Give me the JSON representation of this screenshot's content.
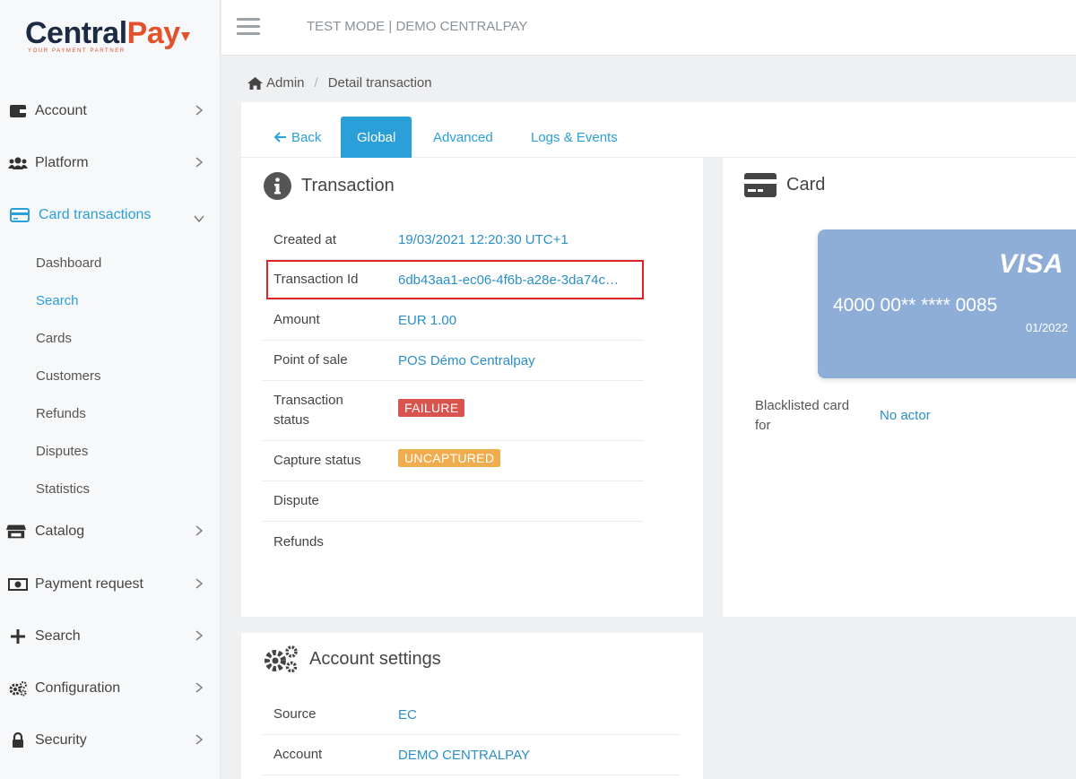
{
  "app": {
    "logo_main_dark": "Central",
    "logo_main_accent": "Pay",
    "logo_tagline": "YOUR PAYMENT PARTNER",
    "mode_label": "TEST MODE | DEMO CENTRALPAY"
  },
  "sidebar": {
    "items": [
      {
        "label": "Account",
        "icon": "wallet-icon"
      },
      {
        "label": "Platform",
        "icon": "users-icon"
      },
      {
        "label": "Card transactions",
        "icon": "credit-card-icon"
      },
      {
        "label": "Catalog",
        "icon": "store-icon"
      },
      {
        "label": "Payment request",
        "icon": "money-bill-icon"
      },
      {
        "label": "Search",
        "icon": "plus-icon"
      },
      {
        "label": "Configuration",
        "icon": "cogs-icon"
      },
      {
        "label": "Security",
        "icon": "lock-icon"
      }
    ],
    "subitems": [
      "Dashboard",
      "Search",
      "Cards",
      "Customers",
      "Refunds",
      "Disputes",
      "Statistics"
    ]
  },
  "breadcrumb": {
    "home": "Admin",
    "current": "Detail transaction"
  },
  "tabs": {
    "back": "Back",
    "global": "Global",
    "advanced": "Advanced",
    "logs": "Logs & Events"
  },
  "transaction": {
    "title": "Transaction",
    "rows": [
      {
        "label": "Created at",
        "value": "19/03/2021 12:20:30 UTC+1"
      },
      {
        "label": "Transaction Id",
        "value": "6db43aa1-ec06-4f6b-a28e-3da74c…"
      },
      {
        "label": "Amount",
        "value": "EUR 1.00"
      },
      {
        "label": "Point of sale",
        "value": "POS Démo Centralpay"
      },
      {
        "label_line1": "Transaction",
        "label_line2": "status",
        "value": "FAILURE"
      },
      {
        "label": "Capture status",
        "value": "UNCAPTURED"
      },
      {
        "label": "Dispute",
        "value": ""
      },
      {
        "label": "Refunds",
        "value": ""
      }
    ]
  },
  "card": {
    "title": "Card",
    "brand": "VISA",
    "number": "4000 00** **** 0085",
    "expiry": "01/2022",
    "blacklist_label_line1": "Blacklisted card",
    "blacklist_label_line2": "for",
    "blacklist_value": "No actor"
  },
  "account_settings": {
    "title": "Account settings",
    "rows": [
      {
        "label": "Source",
        "value": "EC"
      },
      {
        "label": "Account",
        "value": "DEMO CENTRALPAY"
      }
    ]
  },
  "colors": {
    "accent": "#2a9fd8",
    "failure": "#d9534f",
    "uncaptured": "#f0ad4e",
    "card": "#8eaed8",
    "highlight": "#e02424"
  }
}
